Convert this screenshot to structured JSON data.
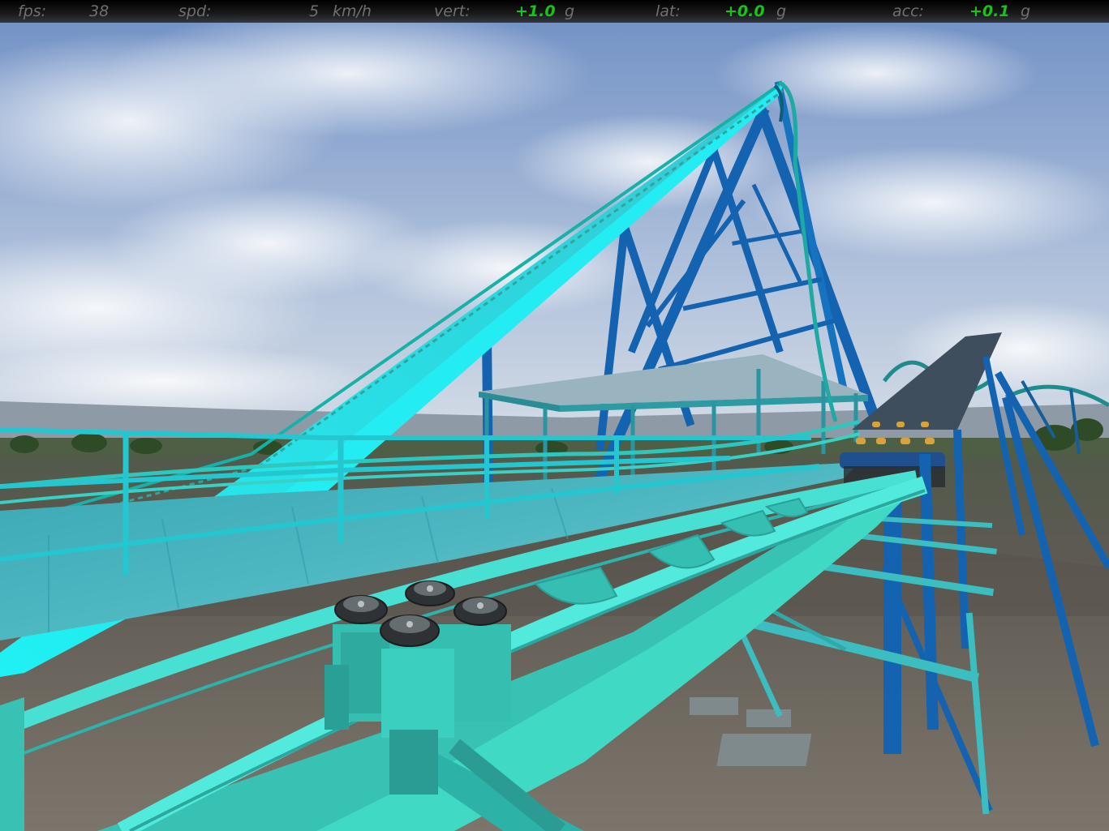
{
  "hud": {
    "fps_label": "fps:",
    "fps_value": "38",
    "spd_label": "spd:",
    "spd_value": "5",
    "spd_unit": "km/h",
    "vert_label": "vert:",
    "vert_value": "+1.0",
    "vert_unit": "g",
    "lat_label": "lat:",
    "lat_value": "+0.0",
    "lat_unit": "g",
    "acc_label": "acc:",
    "acc_value": "+0.1",
    "acc_unit": "g"
  },
  "colors": {
    "track_main": "#3fd9c4",
    "track_lift": "#22e6ee",
    "supports": "#1363b0",
    "hud_green": "#19c319",
    "hud_grey": "#6f6f6f"
  }
}
